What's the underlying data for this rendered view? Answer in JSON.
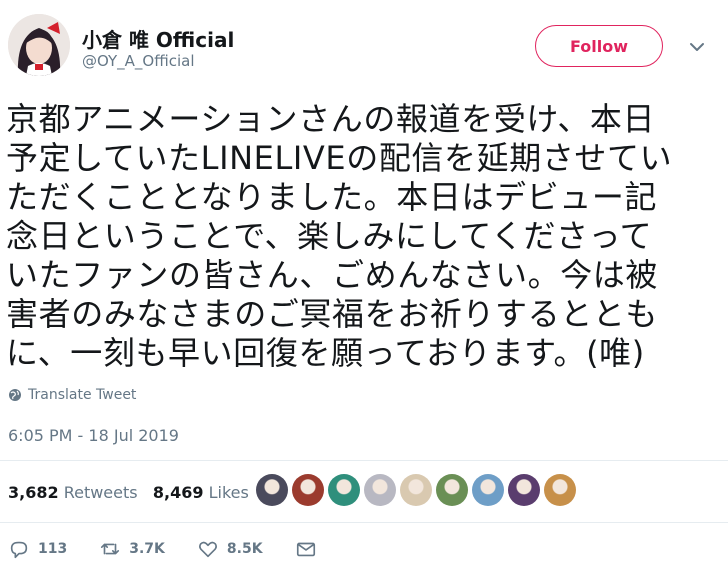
{
  "author": {
    "name": "小倉 唯 Official",
    "handle": "@OY_A_Official",
    "avatar_icon": "profile-photo"
  },
  "header": {
    "follow_label": "Follow",
    "menu_icon": "chevron-down-icon"
  },
  "tweet": {
    "lines": [
      "京都アニメーションさんの報道を受け、本日",
      "予定していたLINELIVEの配信を延期させてい",
      "ただくこととなりました。本日はデビュー記",
      "念日ということで、楽しみにしてくださって",
      "いたファンの皆さん、ごめんなさい。今は被",
      "害者のみなさまのご冥福をお祈りするととも",
      "に、一刻も早い回復を願っております。(唯)"
    ],
    "translate_label": "Translate Tweet",
    "timestamp": "6:05 PM - 18 Jul 2019"
  },
  "stats": {
    "retweets_count": "3,682",
    "retweets_label": "Retweets",
    "likes_count": "8,469",
    "likes_label": "Likes"
  },
  "likers_colors": [
    "#4a4a5c",
    "#9b3b2e",
    "#2f8f7c",
    "#b8b8c2",
    "#d9c9b0",
    "#6a8f55",
    "#6e9ec7",
    "#5a3d6e",
    "#c7904a"
  ],
  "actions": {
    "replies": "113",
    "retweets": "3.7K",
    "likes": "8.5K"
  },
  "colors": {
    "accent_follow": "#e0245e",
    "muted": "#657786",
    "text": "#14171a"
  }
}
